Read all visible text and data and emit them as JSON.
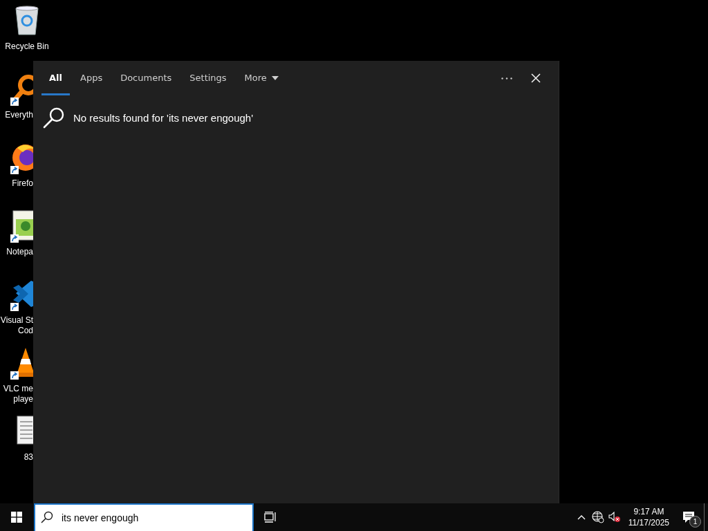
{
  "desktop_icons": [
    {
      "kind": "recycle-bin",
      "label_lines": [
        "Recycle Bin"
      ],
      "shortcut": false
    },
    {
      "kind": "search-app",
      "label_lines": [
        "Everyth"
      ],
      "shortcut": true
    },
    {
      "kind": "browser",
      "label_lines": [
        "Firefo"
      ],
      "shortcut": true
    },
    {
      "kind": "notepad",
      "label_lines": [
        "Notepa"
      ],
      "shortcut": true
    },
    {
      "kind": "code-editor",
      "label_lines": [
        "Visual St",
        "Cod"
      ],
      "shortcut": true
    },
    {
      "kind": "media-player",
      "label_lines": [
        "VLC me",
        "playe"
      ],
      "shortcut": true
    },
    {
      "kind": "document",
      "label_lines": [
        "83"
      ],
      "shortcut": false
    }
  ],
  "search_panel": {
    "tabs": [
      {
        "label": "All",
        "selected": true,
        "kind": "plain"
      },
      {
        "label": "Apps",
        "selected": false,
        "kind": "plain"
      },
      {
        "label": "Documents",
        "selected": false,
        "kind": "plain"
      },
      {
        "label": "Settings",
        "selected": false,
        "kind": "plain"
      },
      {
        "label": "More",
        "selected": false,
        "kind": "dropdown"
      }
    ],
    "message": "No results found for 'its never engough'"
  },
  "taskbar": {
    "search_field": {
      "value": "its never engough"
    },
    "time": "9:17 AM",
    "date": "11/17/2025",
    "notification_count": "1"
  }
}
